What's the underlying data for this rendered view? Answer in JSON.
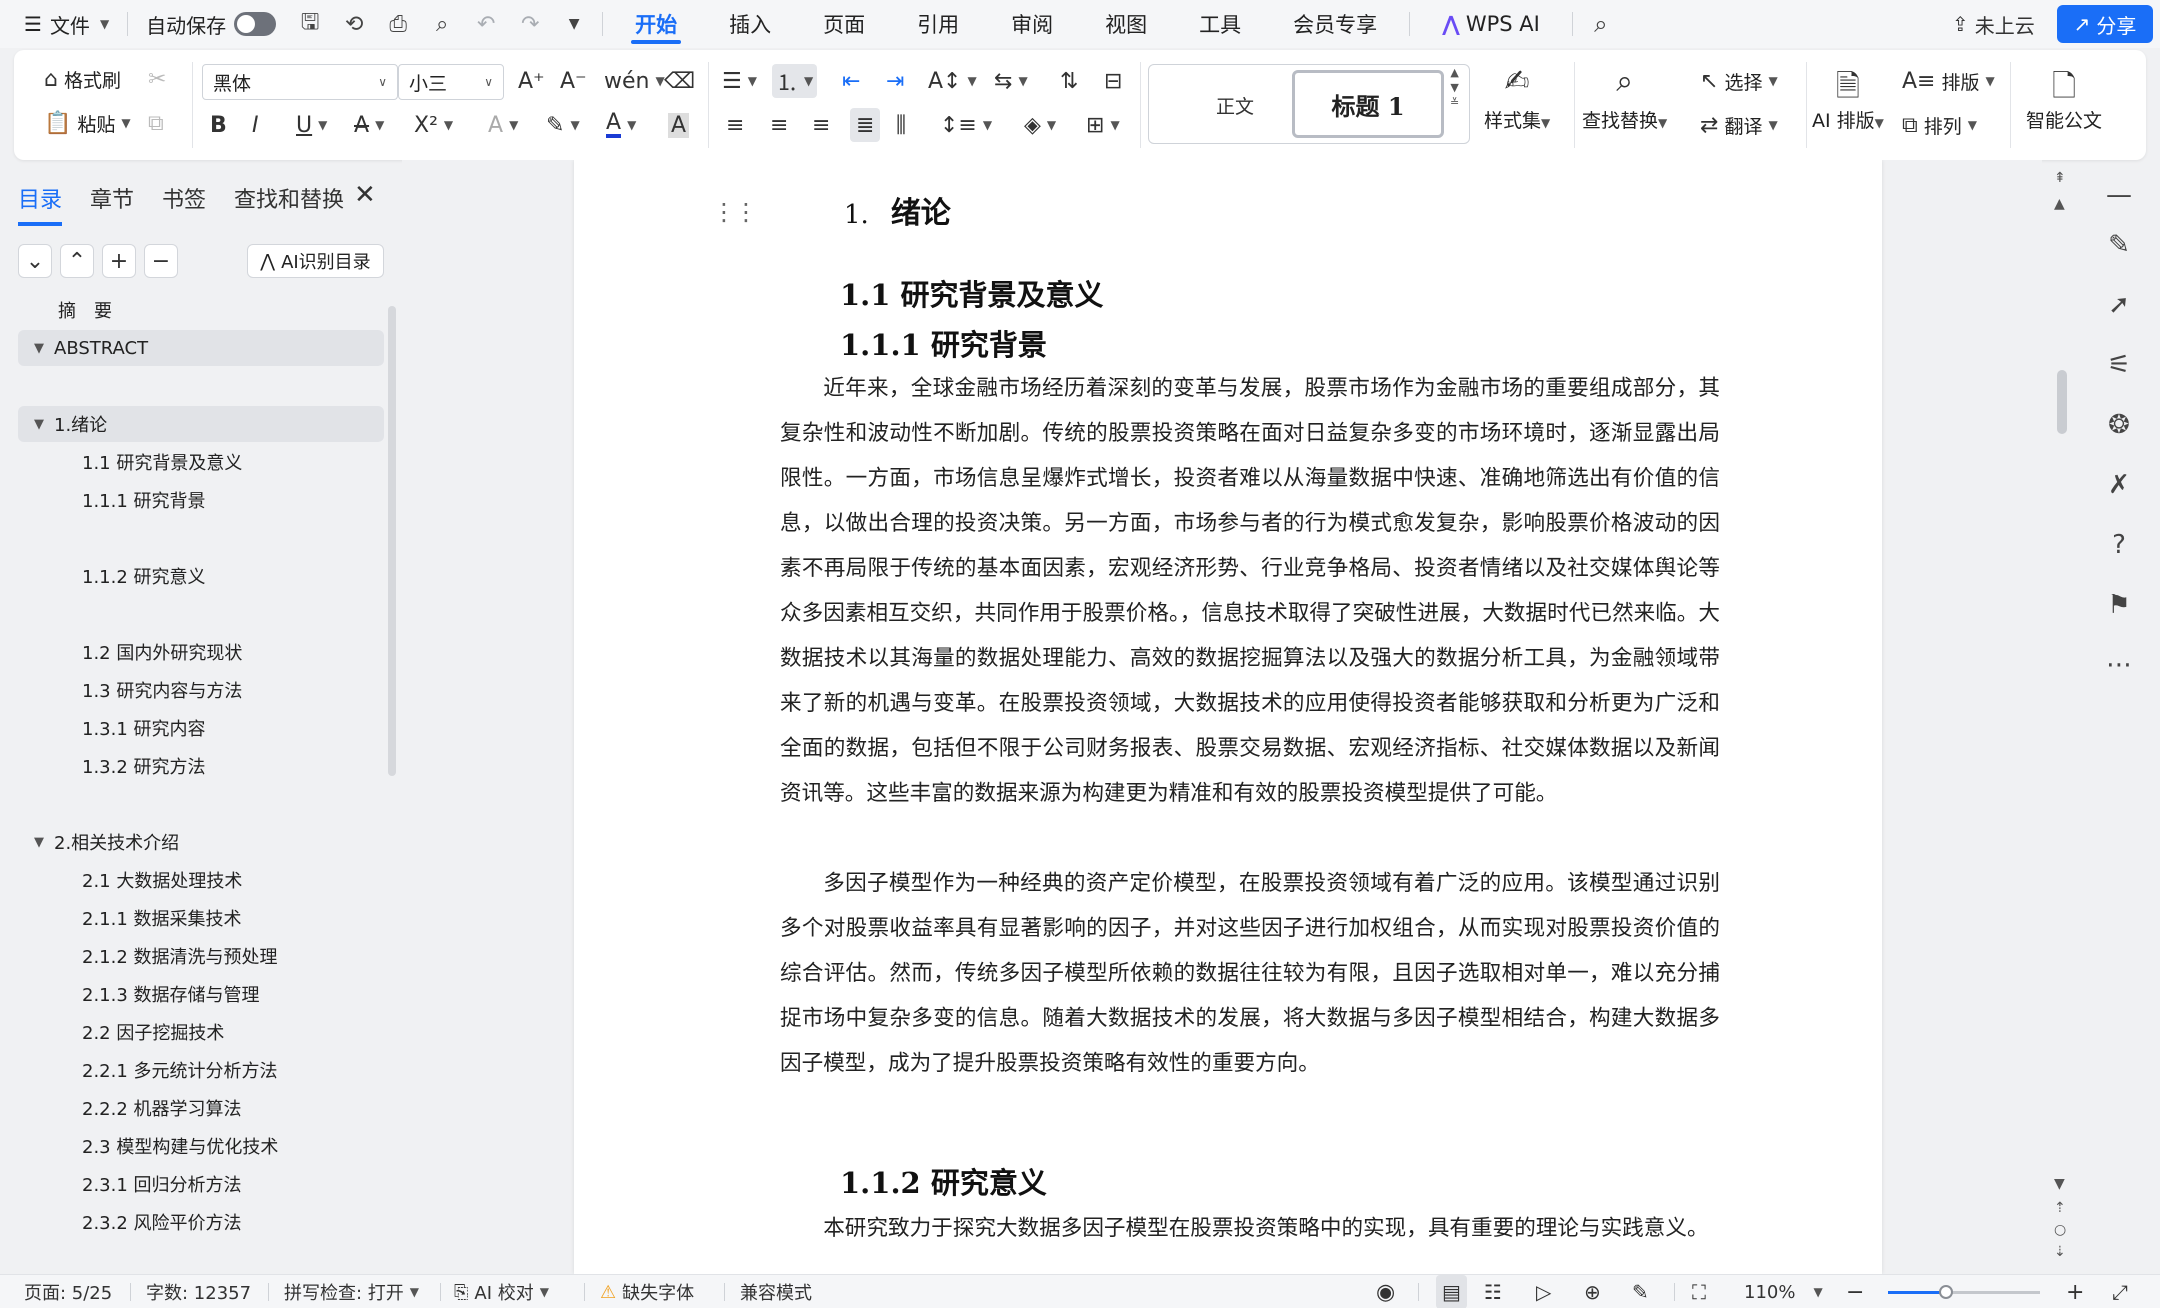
{
  "menubar": {
    "file": "文件",
    "autosave": "自动保存",
    "tabs": [
      "开始",
      "插入",
      "页面",
      "引用",
      "审阅",
      "视图",
      "工具",
      "会员专享"
    ],
    "wps_ai": "WPS AI",
    "cloud": "未上云",
    "share": "分享"
  },
  "ribbon": {
    "format_painter": "格式刷",
    "paste": "粘贴",
    "font_name": "黑体",
    "font_size": "小三",
    "style_normal": "正文",
    "style_heading1": "标题 1",
    "style_set": "样式集",
    "find_replace": "查找替换",
    "select": "选择",
    "translate": "翻译",
    "ai_layout": "AI 排版",
    "typeset": "排版",
    "arrange": "排列",
    "smart_doc": "智能公文"
  },
  "nav": {
    "tabs": [
      "目录",
      "章节",
      "书签",
      "查找和替换"
    ],
    "ai_toc": "AI识别目录",
    "toc": [
      {
        "label": "摘　要",
        "level": 1,
        "arrow": ""
      },
      {
        "label": "ABSTRACT",
        "level": 1,
        "arrow": "▼",
        "hl": true
      },
      {
        "label": "1.绪论",
        "level": 1,
        "arrow": "▼",
        "hl": true
      },
      {
        "label": "1.1  研究背景及意义",
        "level": 2
      },
      {
        "label": "1.1.1  研究背景",
        "level": 2
      },
      {
        "label": "1.1.2  研究意义",
        "level": 2
      },
      {
        "label": "1.2  国内外研究现状",
        "level": 2
      },
      {
        "label": "1.3  研究内容与方法",
        "level": 2
      },
      {
        "label": "1.3.1  研究内容",
        "level": 2
      },
      {
        "label": "1.3.2  研究方法",
        "level": 2
      },
      {
        "label": "2.相关技术介绍",
        "level": 1,
        "arrow": "▼"
      },
      {
        "label": "2.1  大数据处理技术",
        "level": 2
      },
      {
        "label": "2.1.1  数据采集技术",
        "level": 2
      },
      {
        "label": "2.1.2  数据清洗与预处理",
        "level": 2
      },
      {
        "label": "2.1.3  数据存储与管理",
        "level": 2
      },
      {
        "label": "2.2  因子挖掘技术",
        "level": 2
      },
      {
        "label": "2.2.1  多元统计分析方法",
        "level": 2
      },
      {
        "label": "2.2.2  机器学习算法",
        "level": 2
      },
      {
        "label": "2.3  模型构建与优化技术",
        "level": 2
      },
      {
        "label": "2.3.1  回归分析方法",
        "level": 2
      },
      {
        "label": "2.3.2  风险平价方法",
        "level": 2
      }
    ]
  },
  "doc": {
    "h1_num": "1.",
    "h1_text": "绪论",
    "h2": "1.1  研究背景及意义",
    "h3a": "1.1.1  研究背景",
    "p1": "近年来，全球金融市场经历着深刻的变革与发展，股票市场作为金融市场的重要组成部分，其复杂性和波动性不断加剧。传统的股票投资策略在面对日益复杂多变的市场环境时，逐渐显露出局限性。一方面，市场信息呈爆炸式增长，投资者难以从海量数据中快速、准确地筛选出有价值的信息，以做出合理的投资决策。另一方面，市场参与者的行为模式愈发复杂，影响股票价格波动的因素不再局限于传统的基本面因素，宏观经济形势、行业竞争格局、投资者情绪以及社交媒体舆论等众多因素相互交织，共同作用于股票价格。，信息技术取得了突破性进展，大数据时代已然来临。大数据技术以其海量的数据处理能力、高效的数据挖掘算法以及强大的数据分析工具，为金融领域带来了新的机遇与变革。在股票投资领域，大数据技术的应用使得投资者能够获取和分析更为广泛和全面的数据，包括但不限于公司财务报表、股票交易数据、宏观经济指标、社交媒体数据以及新闻资讯等。这些丰富的数据来源为构建更为精准和有效的股票投资模型提供了可能。",
    "p2": "多因子模型作为一种经典的资产定价模型，在股票投资领域有着广泛的应用。该模型通过识别多个对股票收益率具有显著影响的因子，并对这些因子进行加权组合，从而实现对股票投资价值的综合评估。然而，传统多因子模型所依赖的数据往往较为有限，且因子选取相对单一，难以充分捕捉市场中复杂多变的信息。随着大数据技术的发展，将大数据与多因子模型相结合，构建大数据多因子模型，成为了提升股票投资策略有效性的重要方向。",
    "h3b": "1.1.2  研究意义",
    "p3": "本研究致力于探究大数据多因子模型在股票投资策略中的实现，具有重要的理论与实践意义。"
  },
  "status": {
    "page": "页面: 5/25",
    "words": "字数: 12357",
    "spell": "拼写检查: 打开",
    "ai_proof": "AI 校对",
    "missing_font": "缺失字体",
    "compat": "兼容模式",
    "zoom": "110%",
    "zoom_fraction": 0.38
  },
  "colors": {
    "accent": "#1a6ef7",
    "warning": "#f0a020"
  }
}
